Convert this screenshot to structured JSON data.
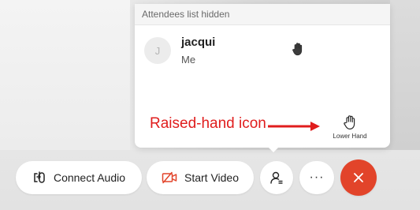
{
  "panel": {
    "header": "Attendees list hidden",
    "attendee": {
      "avatar_initial": "J",
      "name": "jacqui",
      "subtitle": "Me",
      "hand_raised": true
    },
    "lower_hand_label": "Lower Hand"
  },
  "annotation": {
    "text": "Raised-hand icon",
    "color": "#e01d1d"
  },
  "controls": {
    "connect_audio_label": "Connect Audio",
    "start_video_label": "Start Video",
    "more_label": "···",
    "leave_color": "#e2442a",
    "video_icon_color": "#e2442a"
  }
}
